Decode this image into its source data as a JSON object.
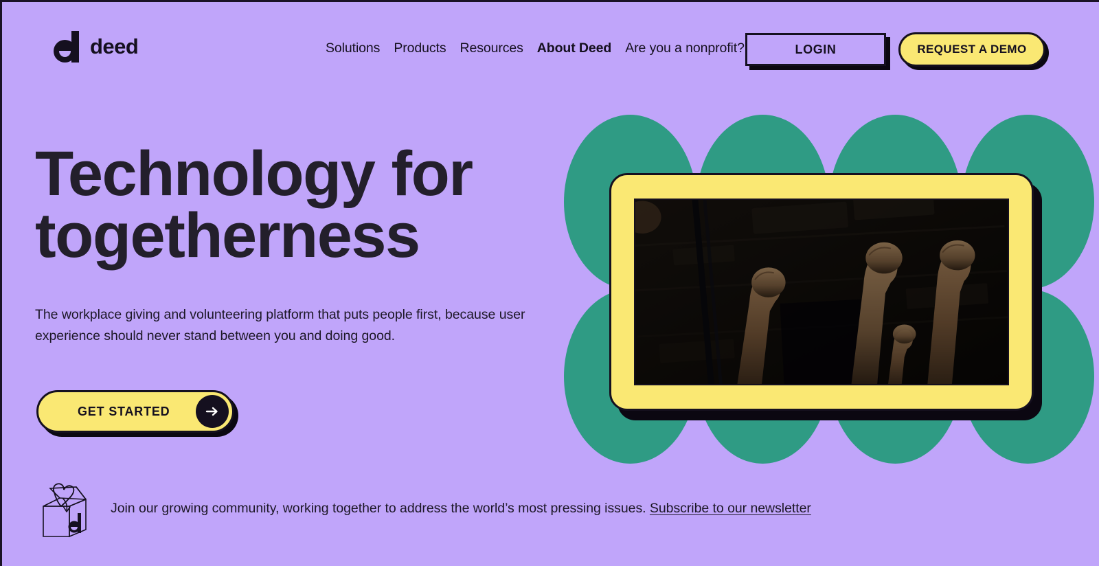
{
  "brand": {
    "logo_text": "deed",
    "logo_icon": "deed-d-logo-icon",
    "purple": "#c0a5fa",
    "yellow": "#fae873",
    "green": "#2f9b84",
    "ink": "#15101f"
  },
  "header": {
    "nav": [
      {
        "label": "Solutions",
        "emphasis": false
      },
      {
        "label": "Products",
        "emphasis": false
      },
      {
        "label": "Resources",
        "emphasis": false
      },
      {
        "label": "About Deed",
        "emphasis": true
      },
      {
        "label": "Are you a nonprofit?",
        "emphasis": false
      }
    ],
    "login_label": "LOGIN",
    "demo_label": "REQUEST A DEMO"
  },
  "hero": {
    "headline": "Technology for togetherness",
    "subhead": "The workplace giving and volunteering platform that puts people first, because user experience should never stand between you and doing good.",
    "cta_label": "GET STARTED",
    "cta_icon": "arrow-right-icon",
    "media": {
      "type": "video",
      "alt": "Dark photo of several raised fists in the air in front of a building facade at night",
      "frame_color": "#fae873"
    }
  },
  "footnote": {
    "icon": "donation-box-heart-icon",
    "text": "Join our growing community, working together to address the world’s most pressing issues.",
    "link_label": "Subscribe to our newsletter"
  }
}
